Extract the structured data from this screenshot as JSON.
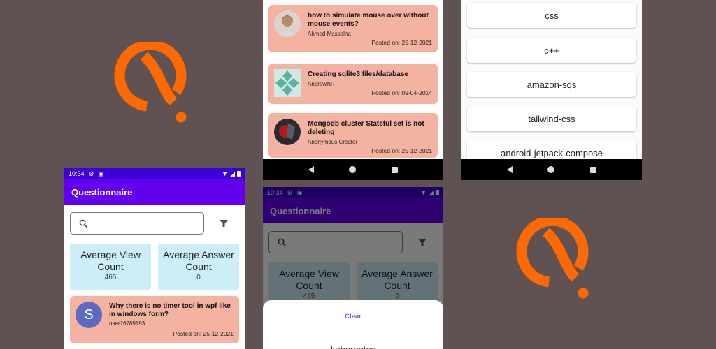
{
  "colors": {
    "background": "#605252",
    "brand_orange": "#ff6a00",
    "status_bar": "#3b00d6",
    "app_bar": "#6200ee",
    "stat_card": "#cdeef7",
    "question_card": "#f3b3a0",
    "clear_text": "#7c4dff"
  },
  "status_bar": {
    "time": "10:34",
    "icons": [
      "settings-icon",
      "sync-icon",
      "wifi-icon",
      "signal-icon",
      "battery-icon"
    ]
  },
  "app": {
    "title": "Questionnaire"
  },
  "search": {
    "placeholder": "",
    "icon": "search-icon",
    "filter_icon": "filter-icon"
  },
  "stats": {
    "average_view": {
      "label": "Average View Count",
      "value": "465"
    },
    "average_answer": {
      "label": "Average Answer Count",
      "value": "0"
    }
  },
  "questions": [
    {
      "title": "Why there is no timer tool in wpf like in windows form?",
      "user": "user16789193",
      "date": "Posted on: 25-12-2021",
      "avatar_letter": "S"
    },
    {
      "title": "how to simulate mouse over without mouse events?",
      "user": "Ahmed Massalha",
      "date": "Posted on: 25-12-2021"
    },
    {
      "title": "Creating sqlite3 files/database",
      "user": "AndrewNR",
      "date": "Posted on: 09-04-2014"
    },
    {
      "title": "Mongodb cluster Stateful set is not deleting",
      "user": "Anonymous Creator",
      "date": "Posted on: 25-12-2021"
    }
  ],
  "tags": [
    "css",
    "c++",
    "amazon-sqs",
    "tailwind-css",
    "android-jetpack-compose"
  ],
  "sheet": {
    "clear_label": "Clear",
    "first_tag": "kubernetes"
  },
  "nav_icons": [
    "back-icon",
    "home-icon",
    "recents-icon"
  ]
}
